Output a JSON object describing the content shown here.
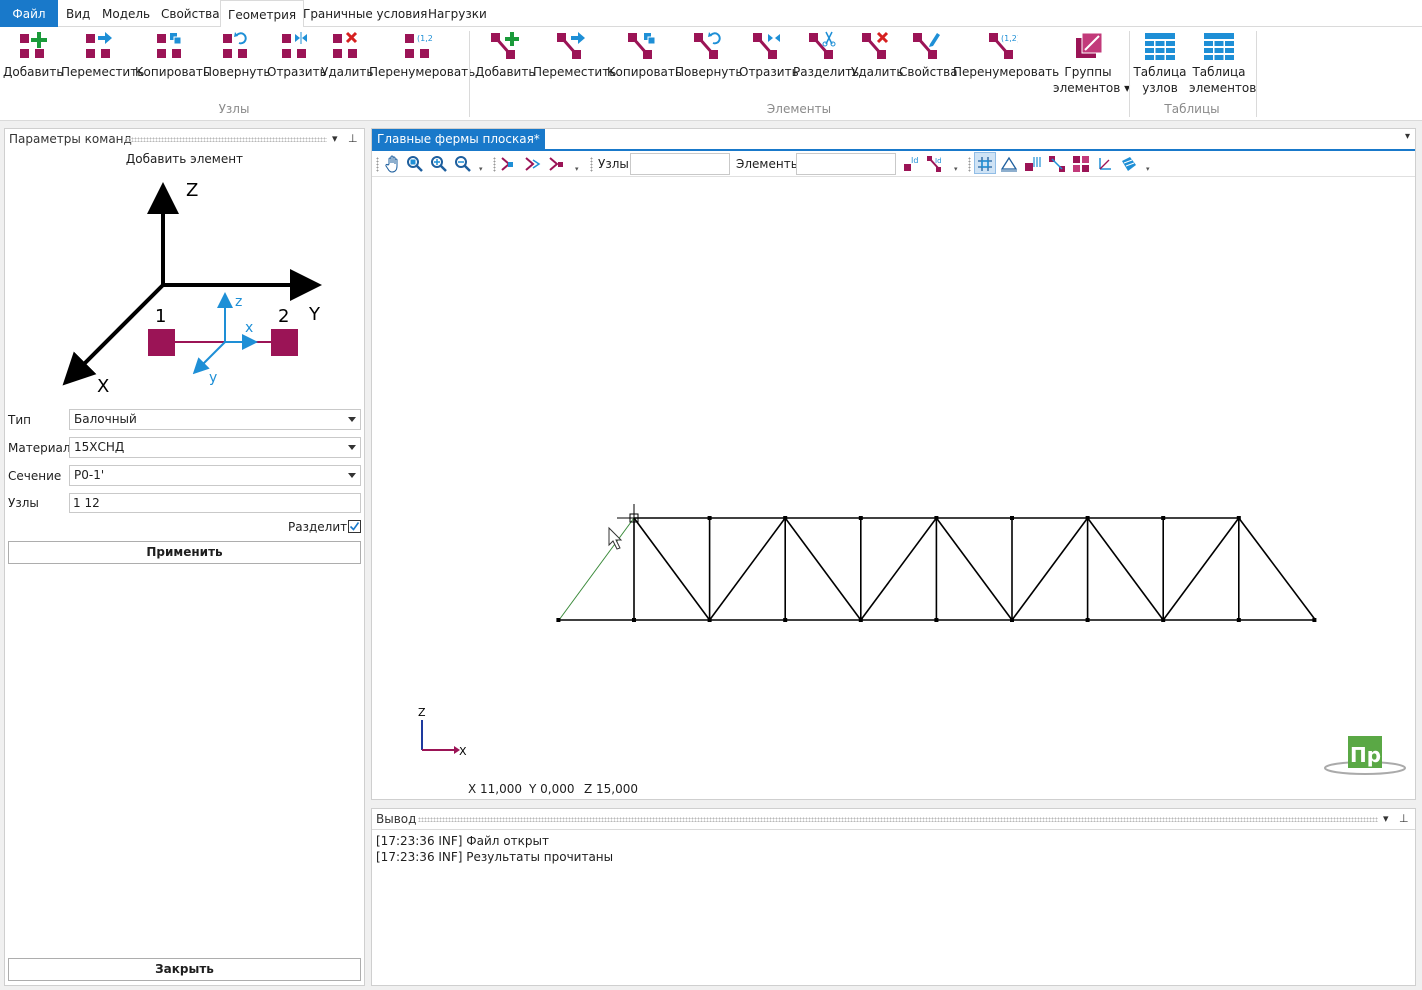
{
  "menu": {
    "file": "Файл",
    "tabs": [
      "Вид",
      "Модель",
      "Свойства",
      "Геометрия",
      "Граничные условия",
      "Нагрузки"
    ]
  },
  "ribbon": {
    "nodes_group": "Узлы",
    "elements_group": "Элементы",
    "tables_group": "Таблицы",
    "nodes": [
      "Добавить",
      "Переместить",
      "Копировать",
      "Повернуть",
      "Отразить",
      "Удалить",
      "Перенумеровать"
    ],
    "elements": [
      "Добавить",
      "Переместить",
      "Копировать",
      "Повернуть",
      "Отразить",
      "Разделить",
      "Удалить",
      "Свойства",
      "Перенумеровать"
    ],
    "element_groups": [
      "Группы",
      "элементов ▾"
    ],
    "tables": [
      [
        "Таблица",
        "узлов"
      ],
      [
        "Таблица",
        "элементов"
      ]
    ]
  },
  "command_panel": {
    "title": "Параметры команд",
    "command": "Добавить элемент",
    "diagram": {
      "Z": "Z",
      "Y": "Y",
      "X": "X",
      "n1": "1",
      "n2": "2",
      "lz": "z",
      "lx": "x",
      "ly": "y"
    },
    "type_label": "Тип",
    "type_value": "Балочный",
    "material_label": "Материал",
    "material_value": "15ХСНД",
    "section_label": "Сечение",
    "section_value": "Р0-1'",
    "nodes_label": "Узлы",
    "nodes_value": "1 12",
    "split_label": "Разделить",
    "apply": "Применить",
    "close": "Закрыть"
  },
  "viewport": {
    "tab": "Главные фермы плоская*",
    "nodes_label": "Узлы",
    "elements_label": "Элементы",
    "axis_z": "Z",
    "axis_x": "X",
    "coord_x": "X  11,000",
    "coord_y": "Y  0,000",
    "coord_z": "Z  15,000",
    "logo": "Пр"
  },
  "output": {
    "title": "Вывод",
    "lines": [
      "[17:23:36 INF] Файл открыт",
      "[17:23:36 INF] Результаты прочитаны"
    ]
  },
  "colors": {
    "accent": "#1979ca",
    "magenta": "#9b1456",
    "green": "#1a9a3a",
    "red": "#d62020",
    "blue": "#1e8fd6"
  }
}
